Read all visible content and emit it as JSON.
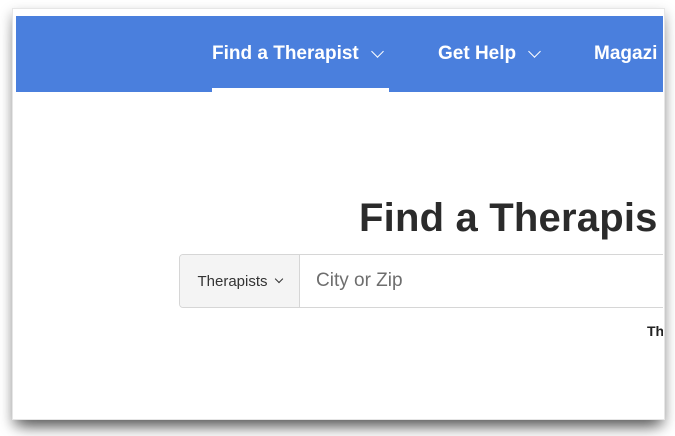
{
  "nav": {
    "items": [
      {
        "label": "Find a Therapist",
        "active": true
      },
      {
        "label": "Get Help",
        "active": false
      },
      {
        "label": "Magazi",
        "active": false
      }
    ],
    "color": "#4a7fdd"
  },
  "main": {
    "title": "Find a Therapis",
    "search": {
      "type_label": "Therapists",
      "placeholder": "City or Zip"
    },
    "truncated_text": "Th"
  },
  "icons": {
    "nav_dropdown": "chevron-down-icon",
    "select_dropdown": "chevron-down-icon"
  }
}
